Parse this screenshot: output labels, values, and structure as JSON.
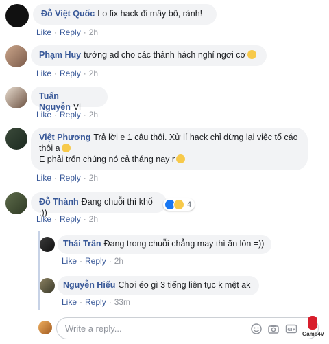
{
  "comments": [
    {
      "author": "Đỗ Việt Quốc",
      "text": "Lo fix hack đi mấy bố, rảnh!",
      "like": "Like",
      "reply": "Reply",
      "time": "2h"
    },
    {
      "author": "Phạm Huy",
      "text": "tưởng ad cho các thánh hách nghỉ ngơi cơ",
      "like": "Like",
      "reply": "Reply",
      "time": "2h"
    },
    {
      "author": "Tuấn Nguyễn",
      "text": "Vl",
      "like": "Like",
      "reply": "Reply",
      "time": "2h"
    },
    {
      "author": "Việt Phương",
      "text_line1": "Trả lời e 1 câu thôi. Xử lí hack chỉ dừng lại việc tố cáo",
      "text_line2": "thôi a",
      "text_line3": "E phải trốn chúng nó cả tháng nay r",
      "like": "Like",
      "reply": "Reply",
      "time": "2h"
    },
    {
      "author": "Đỗ Thành",
      "text": "Đang chuỗi thì khổ :))",
      "reaction_count": "4",
      "like": "Like",
      "reply": "Reply",
      "time": "2h"
    }
  ],
  "replies": [
    {
      "author": "Thái Trần",
      "text": "Đang trong chuỗi chẳng may thì ăn lôn =))",
      "like": "Like",
      "reply": "Reply",
      "time": "2h"
    },
    {
      "author": "Nguyễn Hiếu",
      "text": "Chơi éo gì 3 tiếng liên tục k mệt ak",
      "like": "Like",
      "reply": "Reply",
      "time": "33m"
    }
  ],
  "composer": {
    "placeholder": "Write a reply..."
  },
  "watermark": "Game4V",
  "icons": {
    "emoji": "smiley-icon",
    "camera": "camera-icon",
    "gif": "gif-icon",
    "sticker": "sticker-icon"
  },
  "colors": {
    "link": "#385898",
    "bubble": "#f2f3f5",
    "muted": "#90949c"
  }
}
